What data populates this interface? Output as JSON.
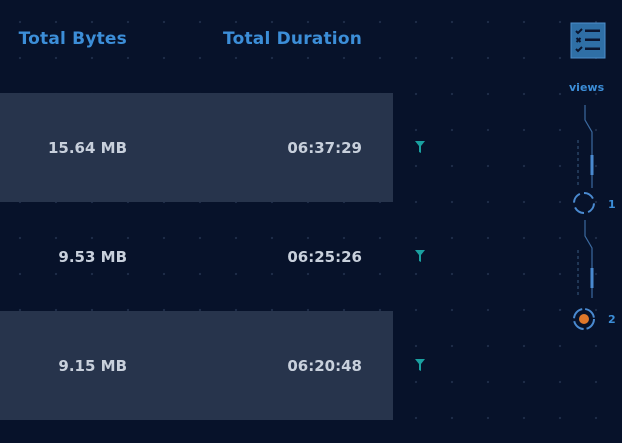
{
  "table": {
    "headers": {
      "bytes": "Total Bytes",
      "duration": "Total Duration"
    },
    "rows": [
      {
        "bytes": "15.64 MB",
        "duration": "06:37:29"
      },
      {
        "bytes": "9.53 MB",
        "duration": "06:25:26"
      },
      {
        "bytes": "9.15 MB",
        "duration": "06:20:48"
      }
    ]
  },
  "sidebar": {
    "icon": "checklist-icon",
    "views_label": "views",
    "views": [
      {
        "number": "1",
        "active": false
      },
      {
        "number": "2",
        "active": true
      }
    ]
  },
  "colors": {
    "background": "#07122a",
    "row_shade": "#27344c",
    "accent_blue": "#3c8ed8",
    "filter_teal": "#1aa0a0",
    "active_dot": "#e0782a"
  }
}
